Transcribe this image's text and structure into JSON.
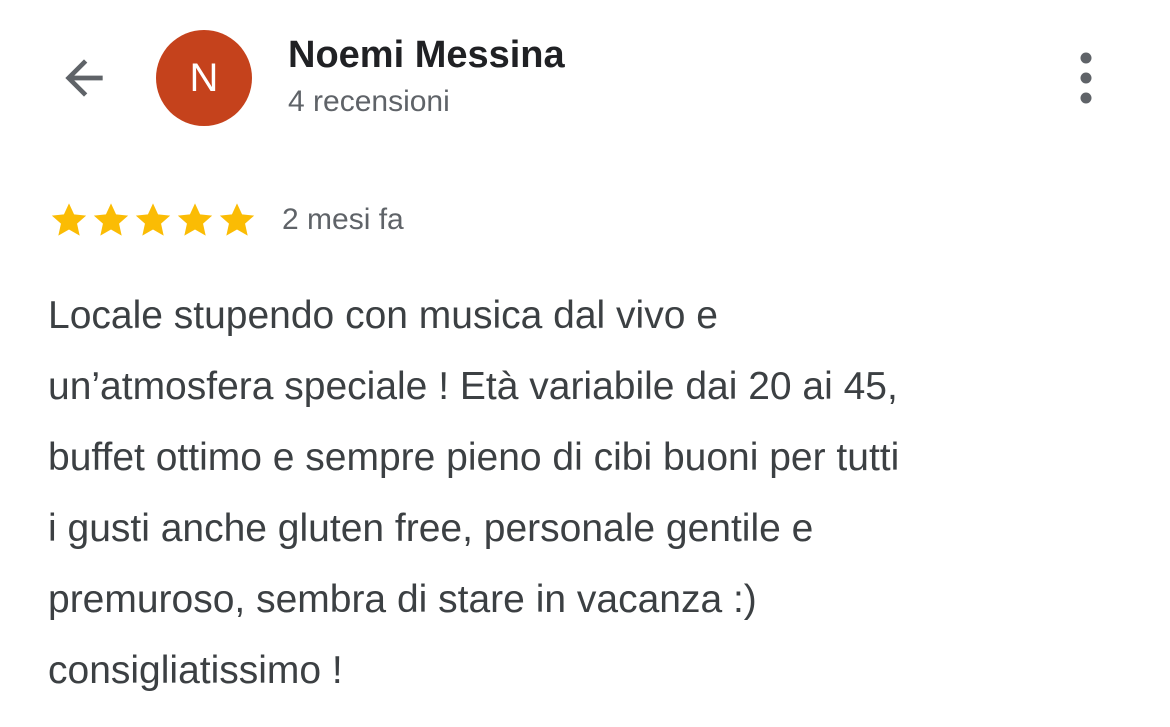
{
  "header": {
    "back_icon": "arrow-back-icon",
    "avatar": {
      "initial": "N",
      "color": "#c5421c"
    },
    "reviewer_name": "Noemi Messina",
    "review_count": "4 recensioni",
    "more_icon": "more-vert-icon"
  },
  "review": {
    "rating": 5,
    "rating_max": 5,
    "star_color": "#fbbc04",
    "star_icon": "star-icon",
    "time": "2 mesi fa",
    "text": "Locale stupendo con musica dal vivo e\nun’atmosfera speciale ! Età variabile dai 20 ai 45,\nbuffet ottimo e sempre pieno di cibi buoni per tutti\ni gusti anche gluten free, personale gentile e\npremuroso, sembra di stare in vacanza :)\nconsigliatissimo !"
  },
  "colors": {
    "icon_gray": "#5f6368",
    "text_dark": "#202124",
    "text_body": "#3c4043"
  }
}
